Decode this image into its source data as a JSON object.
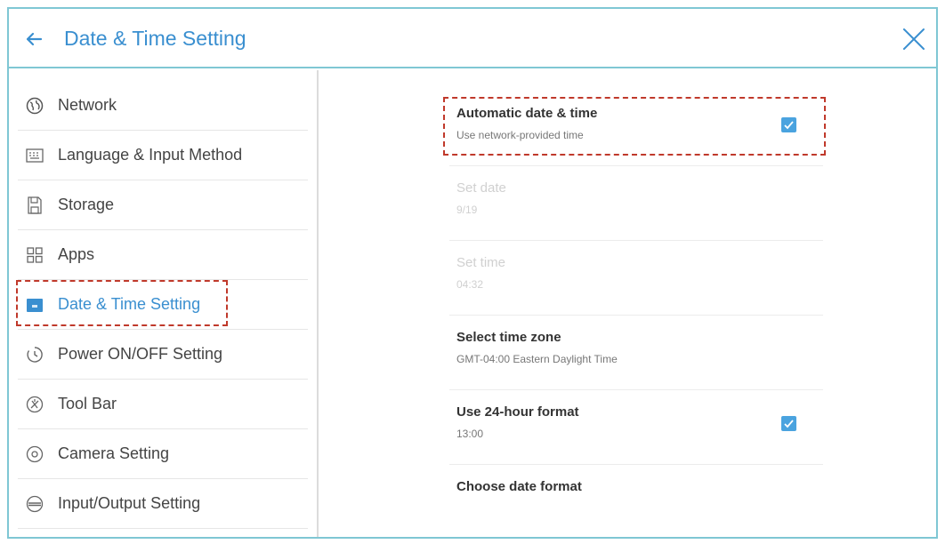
{
  "header": {
    "title": "Date & Time Setting"
  },
  "sidebar": {
    "items": [
      {
        "label": "Network",
        "icon": "globe-icon"
      },
      {
        "label": "Language & Input Method",
        "icon": "keyboard-icon"
      },
      {
        "label": "Storage",
        "icon": "storage-icon"
      },
      {
        "label": "Apps",
        "icon": "apps-grid-icon"
      },
      {
        "label": "Date & Time Setting",
        "icon": "calendar-icon"
      },
      {
        "label": "Power ON/OFF Setting",
        "icon": "power-timer-icon"
      },
      {
        "label": "Tool Bar",
        "icon": "toolbar-icon"
      },
      {
        "label": "Camera Setting",
        "icon": "camera-icon"
      },
      {
        "label": "Input/Output Setting",
        "icon": "input-output-icon"
      }
    ],
    "active_index": 4
  },
  "settings": {
    "auto_time": {
      "title": "Automatic date & time",
      "subtitle": "Use network-provided time",
      "checked": true
    },
    "set_date": {
      "title": "Set date",
      "subtitle": "9/19",
      "enabled": false
    },
    "set_time": {
      "title": "Set time",
      "subtitle": "04:32",
      "enabled": false
    },
    "time_zone": {
      "title": "Select time zone",
      "subtitle": "GMT-04:00 Eastern Daylight Time"
    },
    "hour_format": {
      "title": "Use 24-hour format",
      "subtitle": "13:00",
      "checked": true
    },
    "date_format": {
      "title": "Choose date format"
    }
  },
  "colors": {
    "accent": "#3a8fd0",
    "border": "#7fc7d4",
    "checkbox": "#4aa3df",
    "highlight": "#c0392b"
  }
}
